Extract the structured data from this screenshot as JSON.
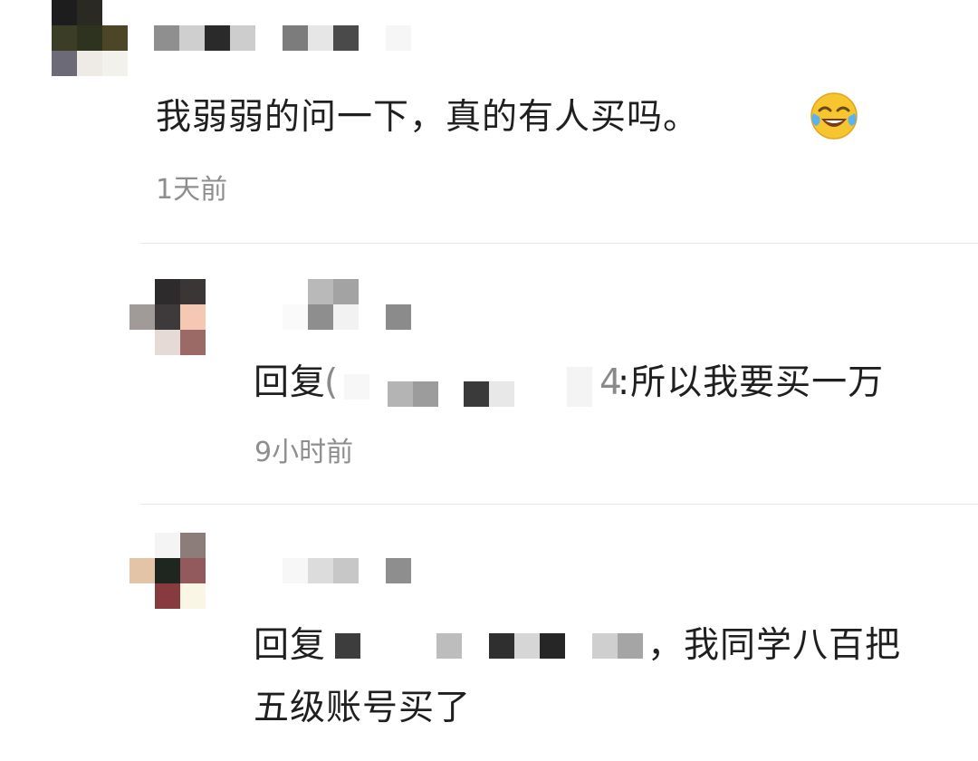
{
  "comments": [
    {
      "text": "我弱弱的问一下，真的有人买吗。",
      "emoji": "tears-of-joy-emoji",
      "time": "1天前"
    }
  ],
  "replies": [
    {
      "prefix": "回复",
      "paren": "(",
      "digit": "4",
      "text": ":所以我要买一万",
      "time": "9小时前"
    },
    {
      "prefix": "回复",
      "text_line1": "，我同学八百把",
      "text_line2": "五级账号买了"
    }
  ]
}
